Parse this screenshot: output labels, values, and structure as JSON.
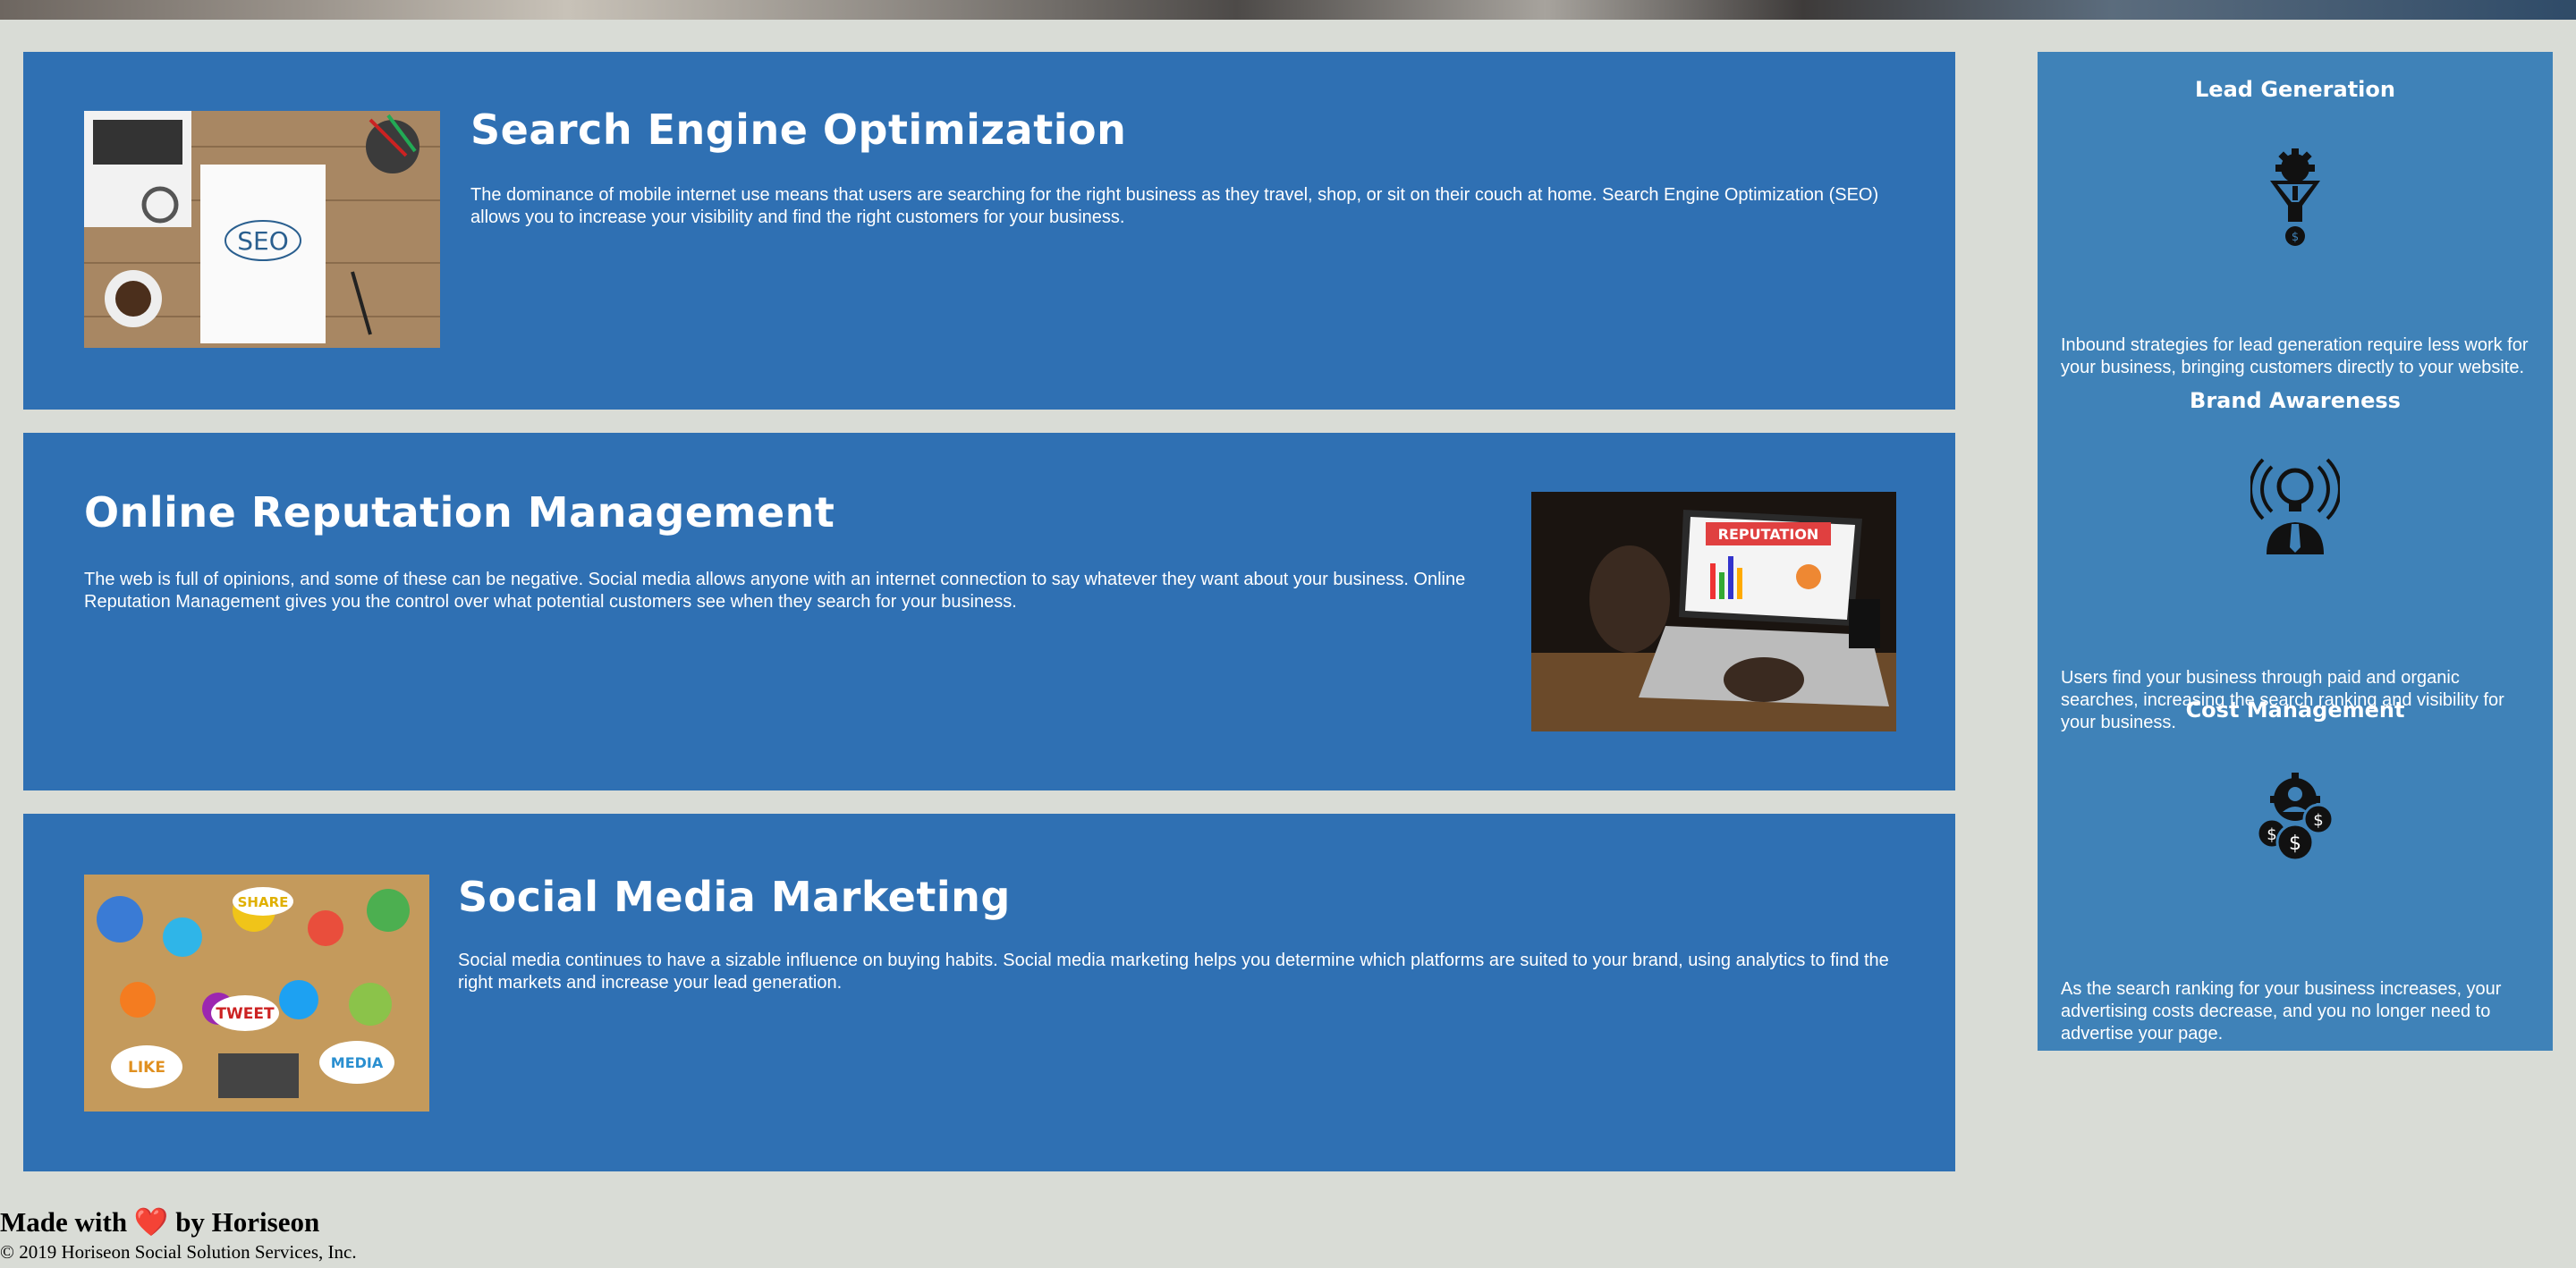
{
  "services": [
    {
      "title": "Search Engine Optimization",
      "description": "The dominance of mobile internet use means that users are searching for the right business as they travel, shop, or sit on their couch at home. Search Engine Optimization (SEO) allows you to increase your visibility and find the right customers for your business.",
      "image_label": "SEO"
    },
    {
      "title": "Online Reputation Management",
      "description": "The web is full of opinions, and some of these can be negative. Social media allows anyone with an internet connection to say whatever they want about your business. Online Reputation Management gives you the control over what potential customers see when they search for your business.",
      "image_label": "REPUTATION"
    },
    {
      "title": "Social Media Marketing",
      "description": "Social media continues to have a sizable influence on buying habits. Social media marketing helps you determine which platforms are suited to your brand, using analytics to find the right markets and increase your lead generation.",
      "image_labels": [
        "SHARE",
        "TWEET",
        "LIKE",
        "MEDIA"
      ]
    }
  ],
  "benefits": [
    {
      "title": "Lead Generation",
      "icon": "lead-generation-funnel-icon",
      "description": "Inbound strategies for lead generation require less work for your business, bringing customers directly to your website."
    },
    {
      "title": "Brand Awareness",
      "icon": "brand-awareness-lightbulb-icon",
      "description": "Users find your business through paid and organic searches, increasing the search ranking and visibility for your business."
    },
    {
      "title": "Cost Management",
      "icon": "cost-management-dollar-icon",
      "description": "As the search ranking for your business increases, your advertising costs decrease, and you no longer need to advertise your page."
    }
  ],
  "footer": {
    "made_prefix": "Made with",
    "heart": "❤️",
    "made_suffix": "by Horiseon",
    "copyright": "© 2019 Horiseon Social Solution Services, Inc."
  },
  "colors": {
    "card_bg": "#2f70b3",
    "sidebar_bg": "#3f82b8",
    "page_bg": "#d9dcd6"
  }
}
